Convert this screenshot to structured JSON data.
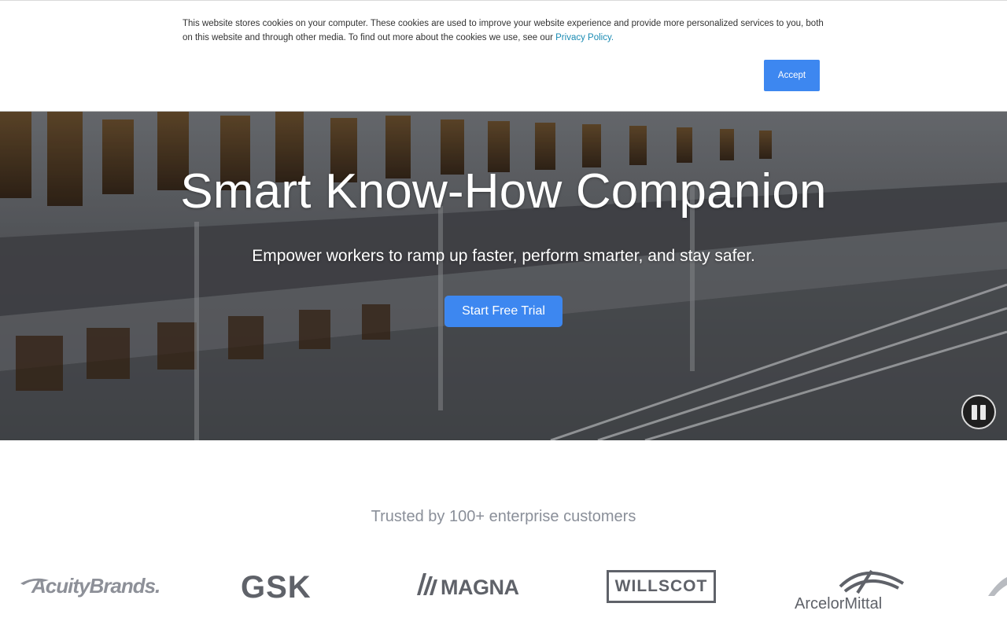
{
  "cookie_banner": {
    "text": "This website stores cookies on your computer. These cookies are used to improve your website experience and provide more personalized services to you, both on this website and through other media. To find out more about the cookies we use, see our ",
    "link_text": "Privacy Policy.",
    "accept_label": "Accept"
  },
  "hero": {
    "title": "Smart Know-How Companion",
    "subtitle": "Empower workers to ramp up faster, perform smarter, and stay safer.",
    "cta_label": "Start Free Trial",
    "pause_icon": "pause-icon"
  },
  "trusted": {
    "heading": "Trusted by 100+ enterprise customers",
    "logos": {
      "acuity": "AcuityBrands.",
      "gsk": "GSK",
      "magna": "MAGNA",
      "willscot": "WILLSCOT",
      "arcelor": "ArcelorMittal"
    }
  },
  "colors": {
    "accent": "#3d87f0",
    "link": "#1a8bb3",
    "logo_gray": "#5f6269",
    "muted_text": "#8a8f99"
  }
}
